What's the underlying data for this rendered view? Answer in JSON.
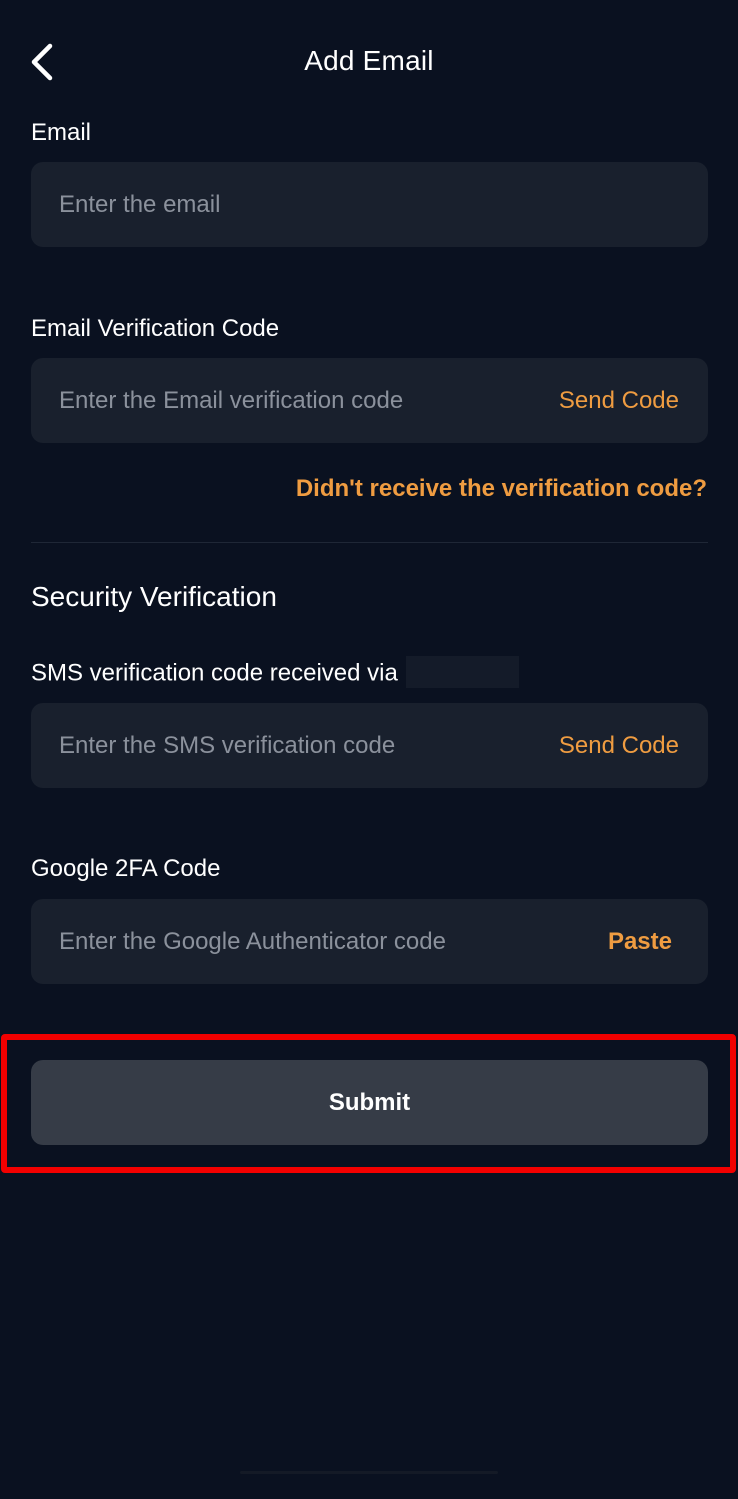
{
  "header": {
    "title": "Add Email",
    "back_icon": "chevron-left-icon"
  },
  "email": {
    "label": "Email",
    "placeholder": "Enter the email",
    "value": ""
  },
  "email_code": {
    "label": "Email Verification Code",
    "placeholder": "Enter the Email verification code",
    "value": "",
    "action_label": "Send Code",
    "help_link": "Didn't receive the verification code?"
  },
  "security": {
    "title": "Security Verification",
    "sms": {
      "label": "SMS verification code received via",
      "placeholder": "Enter the SMS verification code",
      "value": "",
      "action_label": "Send Code"
    },
    "google": {
      "label": "Google 2FA Code",
      "placeholder": "Enter the Google Authenticator code",
      "value": "",
      "action_label": "Paste"
    }
  },
  "submit": {
    "label": "Submit"
  },
  "colors": {
    "background": "#0a1120",
    "field": "#19202d",
    "accent": "#ef9c41",
    "button": "#363c47",
    "highlight": "#f20000"
  }
}
